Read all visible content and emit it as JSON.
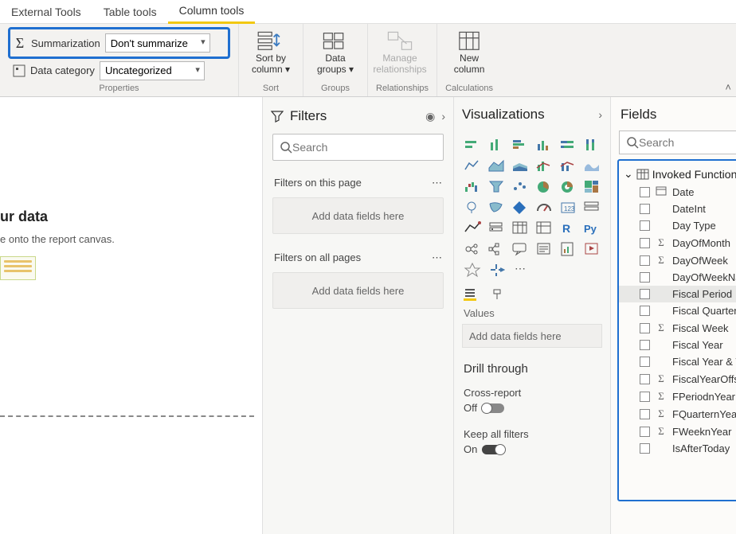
{
  "ribbon_tabs": {
    "external_tools": "External Tools",
    "table_tools": "Table tools",
    "column_tools": "Column tools"
  },
  "properties_group": {
    "summarization_label": "Summarization",
    "summarization_value": "Don't summarize",
    "data_category_label": "Data category",
    "data_category_value": "Uncategorized",
    "group_label": "Properties"
  },
  "sort_group": {
    "sort_by": "Sort by",
    "column": "column",
    "label": "Sort"
  },
  "groups_group": {
    "data": "Data",
    "groups": "groups",
    "label": "Groups"
  },
  "relationships_group": {
    "manage": "Manage",
    "relationships": "relationships",
    "label": "Relationships"
  },
  "calculations_group": {
    "new": "New",
    "column": "column",
    "label": "Calculations"
  },
  "canvas": {
    "title": "ur data",
    "hint": "e onto the report canvas."
  },
  "filters_pane": {
    "title": "Filters",
    "search_placeholder": "Search",
    "on_page": "Filters on this page",
    "on_all": "Filters on all pages",
    "drop_hint": "Add data fields here"
  },
  "viz_pane": {
    "title": "Visualizations",
    "values_label": "Values",
    "values_hint": "Add data fields here",
    "drill_title": "Drill through",
    "cross_report": "Cross-report",
    "off": "Off",
    "keep_all": "Keep all filters",
    "on": "On"
  },
  "fields_pane": {
    "title": "Fields",
    "search_placeholder": "Search",
    "table_name": "Invoked Function",
    "fields": [
      {
        "name": "Date",
        "sigma": false,
        "type": "date",
        "selected": false
      },
      {
        "name": "DateInt",
        "sigma": false,
        "type": "",
        "selected": false
      },
      {
        "name": "Day Type",
        "sigma": false,
        "type": "",
        "selected": false
      },
      {
        "name": "DayOfMonth",
        "sigma": true,
        "type": "",
        "selected": false
      },
      {
        "name": "DayOfWeek",
        "sigma": true,
        "type": "",
        "selected": false
      },
      {
        "name": "DayOfWeekNa...",
        "sigma": false,
        "type": "",
        "selected": false
      },
      {
        "name": "Fiscal Period",
        "sigma": false,
        "type": "",
        "selected": true
      },
      {
        "name": "Fiscal Quarter",
        "sigma": false,
        "type": "",
        "selected": false
      },
      {
        "name": "Fiscal Week",
        "sigma": true,
        "type": "",
        "selected": false
      },
      {
        "name": "Fiscal Year",
        "sigma": false,
        "type": "",
        "selected": false
      },
      {
        "name": "Fiscal Year & W...",
        "sigma": false,
        "type": "",
        "selected": false
      },
      {
        "name": "FiscalYearOffset",
        "sigma": true,
        "type": "",
        "selected": false
      },
      {
        "name": "FPeriodnYear",
        "sigma": true,
        "type": "",
        "selected": false
      },
      {
        "name": "FQuarternYear",
        "sigma": true,
        "type": "",
        "selected": false
      },
      {
        "name": "FWeeknYear",
        "sigma": true,
        "type": "",
        "selected": false
      },
      {
        "name": "IsAfterToday",
        "sigma": false,
        "type": "",
        "selected": false
      }
    ]
  }
}
